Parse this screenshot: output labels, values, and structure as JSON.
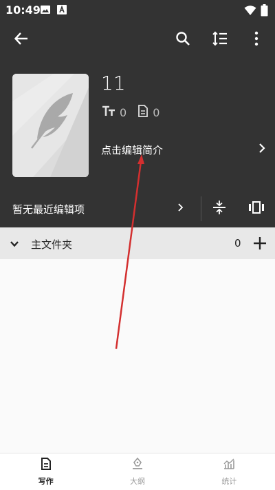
{
  "status_bar": {
    "time": "10:49",
    "icons": [
      "image-icon",
      "a-box-icon",
      "wifi-icon",
      "battery-icon"
    ]
  },
  "toolbar": {
    "back_icon": "arrow-left-icon",
    "search_icon": "search-icon",
    "sort_icon": "sort-icon",
    "more_icon": "more-vertical-icon"
  },
  "book": {
    "title": "11",
    "word_count": "0",
    "chapter_count": "0",
    "intro_placeholder": "点击编辑简介"
  },
  "recent": {
    "label": "暂无最近编辑项"
  },
  "folder": {
    "name": "主文件夹",
    "count": "0"
  },
  "bottom_nav": {
    "items": [
      {
        "label": "写作",
        "icon": "document-icon",
        "active": true
      },
      {
        "label": "大纲",
        "icon": "pen-nib-icon",
        "active": false
      },
      {
        "label": "统计",
        "icon": "chart-icon",
        "active": false
      }
    ]
  },
  "colors": {
    "header_bg": "#333333",
    "folder_row_bg": "#e8e8e8",
    "annotation_arrow": "#d32f2f",
    "page_bg": "#fafafa"
  }
}
